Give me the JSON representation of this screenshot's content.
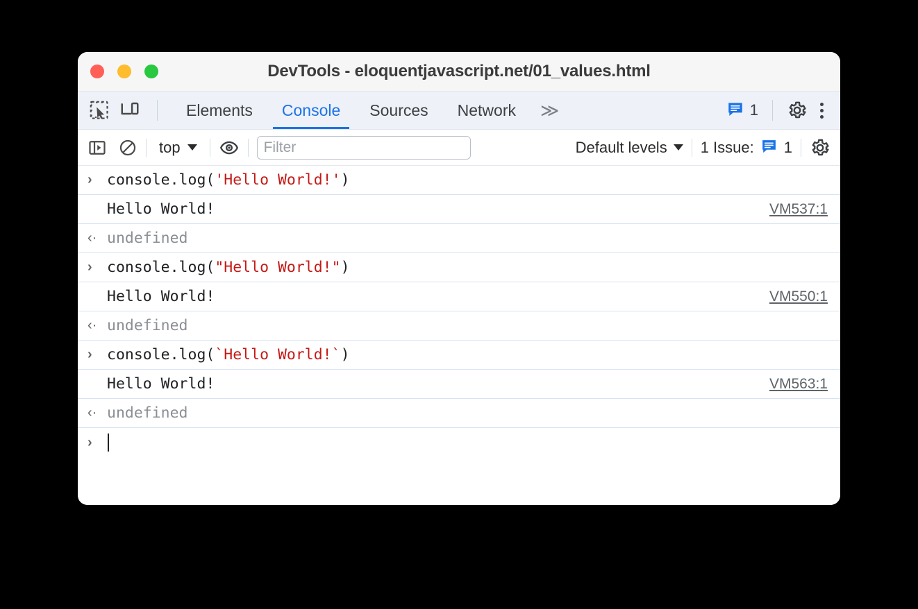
{
  "window": {
    "title": "DevTools - eloquentjavascript.net/01_values.html",
    "traffic_lights": {
      "close_color": "#ff5f57",
      "minimize_color": "#febc2e",
      "maximize_color": "#28c840"
    }
  },
  "tabbar": {
    "inspect_icon": "inspect-element-icon",
    "device_icon": "device-toolbar-icon",
    "tabs": [
      {
        "label": "Elements",
        "active": false
      },
      {
        "label": "Console",
        "active": true
      },
      {
        "label": "Sources",
        "active": false
      },
      {
        "label": "Network",
        "active": false
      }
    ],
    "more_tabs_label": "≫",
    "issue_count": "1",
    "settings_icon": "gear-icon",
    "menu_icon": "kebab-menu-icon",
    "active_color": "#1a73e8"
  },
  "console_toolbar": {
    "sidebar_icon": "console-sidebar-icon",
    "clear_icon": "clear-console-icon",
    "context_label": "top",
    "eye_icon": "live-expression-icon",
    "filter_placeholder": "Filter",
    "filter_value": "",
    "levels_label": "Default levels",
    "issues_label": "1 Issue:",
    "issues_count": "1",
    "settings_icon": "console-settings-gear-icon",
    "issue_badge_color": "#1a73e8"
  },
  "console": {
    "entries": [
      {
        "type": "input",
        "chevron": "›",
        "code_prefix": "console.log(",
        "code_string": "'Hello World!'",
        "code_suffix": ")"
      },
      {
        "type": "output",
        "chevron": "",
        "text": "Hello World!",
        "source": "VM537:1"
      },
      {
        "type": "return",
        "chevron": "‹·",
        "text": "undefined"
      },
      {
        "type": "input",
        "chevron": "›",
        "code_prefix": "console.log(",
        "code_string": "\"Hello World!\"",
        "code_suffix": ")"
      },
      {
        "type": "output",
        "chevron": "",
        "text": "Hello World!",
        "source": "VM550:1"
      },
      {
        "type": "return",
        "chevron": "‹·",
        "text": "undefined"
      },
      {
        "type": "input",
        "chevron": "›",
        "code_prefix": "console.log(",
        "code_string": "`Hello World!`",
        "code_suffix": ")"
      },
      {
        "type": "output",
        "chevron": "",
        "text": "Hello World!",
        "source": "VM563:1"
      },
      {
        "type": "return",
        "chevron": "‹·",
        "text": "undefined"
      }
    ],
    "prompt": {
      "chevron": "›",
      "value": ""
    },
    "string_color": "#c41a16",
    "undefined_color": "#8a8f95"
  }
}
